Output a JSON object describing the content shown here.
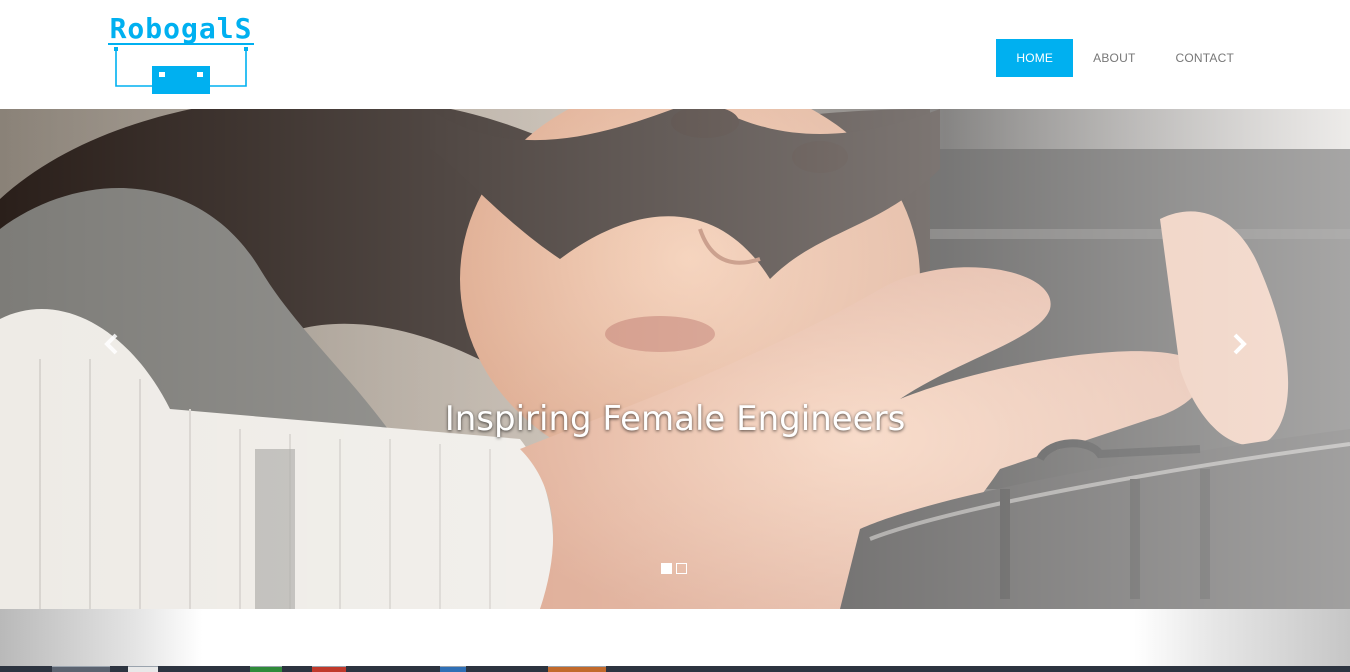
{
  "logo": {
    "text": "RobogalS",
    "brand_color": "#00b0f0"
  },
  "nav": {
    "items": [
      {
        "label": "HOME",
        "active": true
      },
      {
        "label": "ABOUT",
        "active": false
      },
      {
        "label": "CONTACT",
        "active": false
      }
    ]
  },
  "carousel": {
    "caption": "Inspiring Female Engineers",
    "slide_count": 2,
    "active_slide": 1,
    "prev_icon": "chevron-left-icon",
    "next_icon": "chevron-right-icon"
  },
  "colors": {
    "accent": "#00b0f0",
    "nav_text": "#777777",
    "taskbar": "#2d3440"
  }
}
